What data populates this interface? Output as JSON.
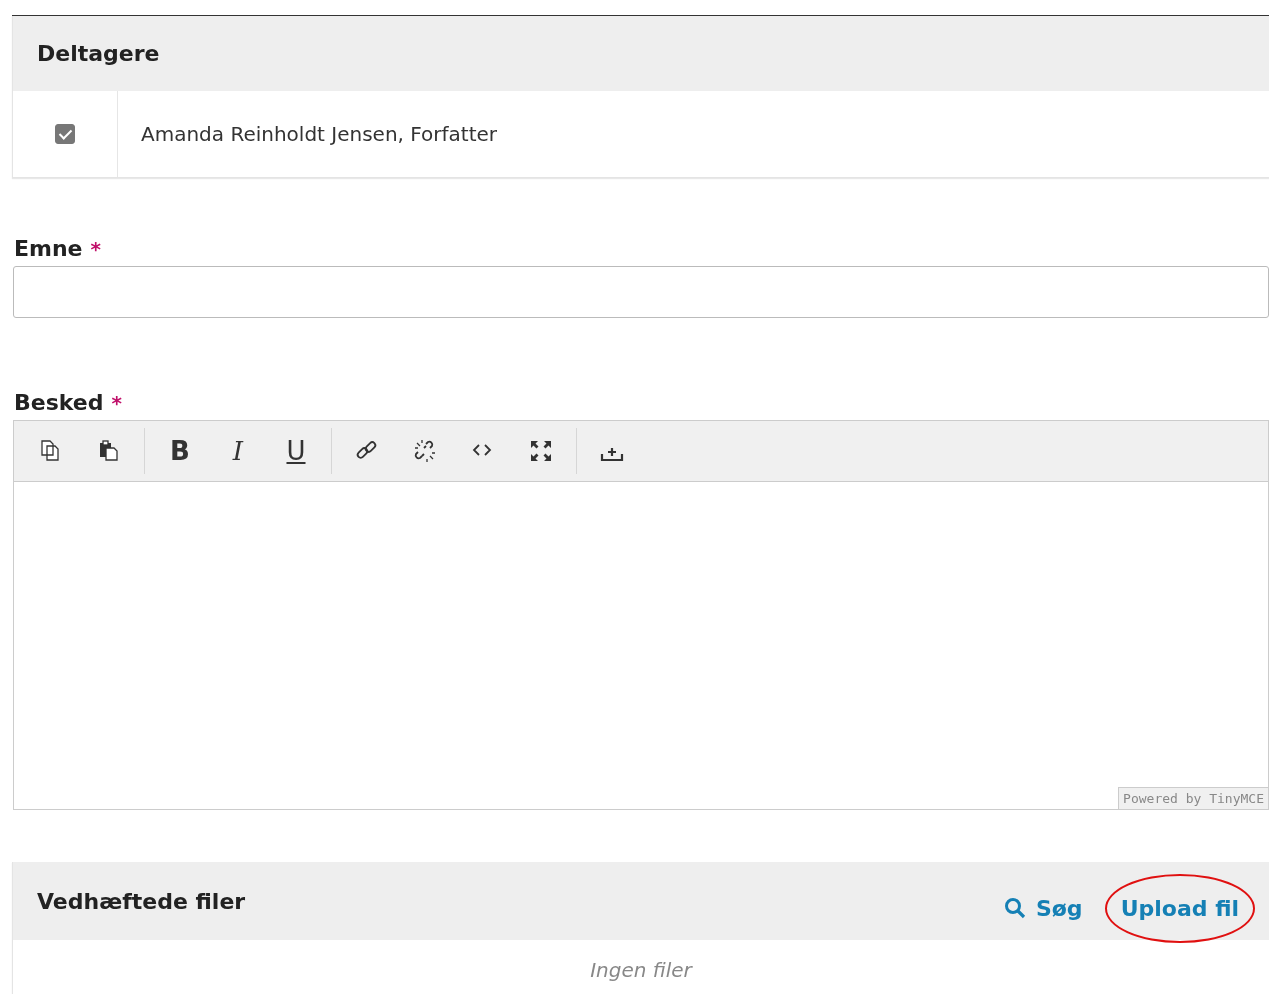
{
  "participants": {
    "title": "Deltagere",
    "rows": [
      {
        "checked": true,
        "name": "Amanda Reinholdt Jensen, Forfatter"
      }
    ]
  },
  "subject": {
    "label": "Emne",
    "required_mark": "*"
  },
  "message": {
    "label": "Besked",
    "required_mark": "*",
    "toolbar": [
      [
        {
          "kind": "copy"
        },
        {
          "kind": "paste"
        }
      ],
      [
        {
          "kind": "bold",
          "label": "B"
        },
        {
          "kind": "italic",
          "label": "I"
        },
        {
          "kind": "underline",
          "label": "U"
        }
      ],
      [
        {
          "kind": "link"
        },
        {
          "kind": "unlink"
        },
        {
          "kind": "code"
        },
        {
          "kind": "fullscreen"
        }
      ],
      [
        {
          "kind": "upload"
        }
      ]
    ],
    "branding": "Powered by TinyMCE"
  },
  "attachments": {
    "title": "Vedhæftede filer",
    "search": "Søg",
    "upload": "Upload fil",
    "upload_highlighted": true,
    "empty": "Ingen filer"
  }
}
